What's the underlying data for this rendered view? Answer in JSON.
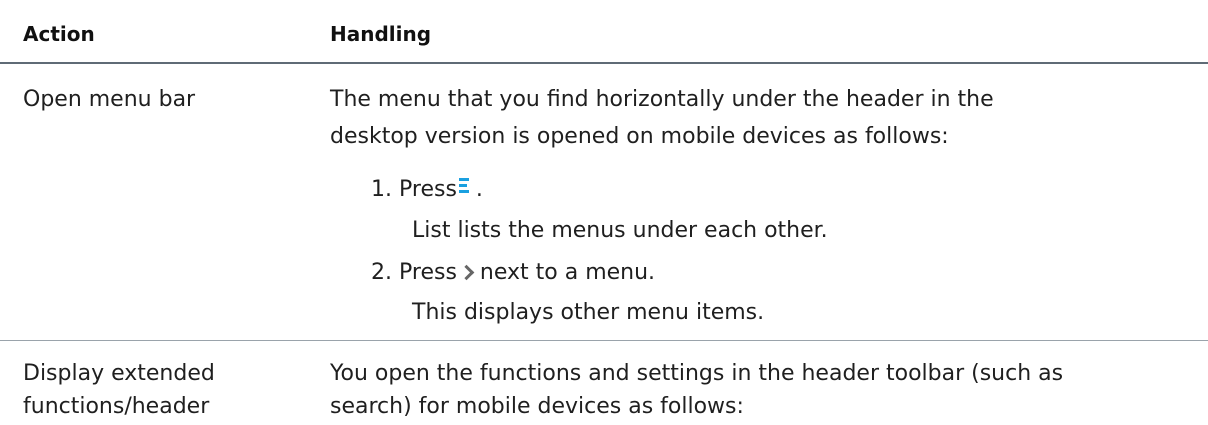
{
  "table": {
    "headers": {
      "action": "Action",
      "handling": "Handling"
    },
    "rows": [
      {
        "action": "Open menu bar",
        "handling_intro_line1": "The menu that you find horizontally under the header in the",
        "handling_intro_line2": "desktop version is opened on mobile devices as follows:",
        "steps": [
          {
            "number": "1.",
            "text": "Press",
            "after_icon": ".",
            "icon": "menu-icon",
            "result": "List lists the menus under each other."
          },
          {
            "number": "2.",
            "text": "Press",
            "after_icon": "next to a menu.",
            "icon": "chevron-right-icon",
            "result": "This displays other menu items."
          }
        ]
      },
      {
        "action_line1": "Display extended",
        "action_line2": "functions/header",
        "handling_line1": "You open the functions and settings in the header toolbar (such as",
        "handling_line2": "search) for mobile devices as follows:"
      }
    ]
  },
  "colors": {
    "icon_accent": "#1aa0e0",
    "header_rule": "#5f6b76",
    "row_rule": "#9aa3ab"
  }
}
